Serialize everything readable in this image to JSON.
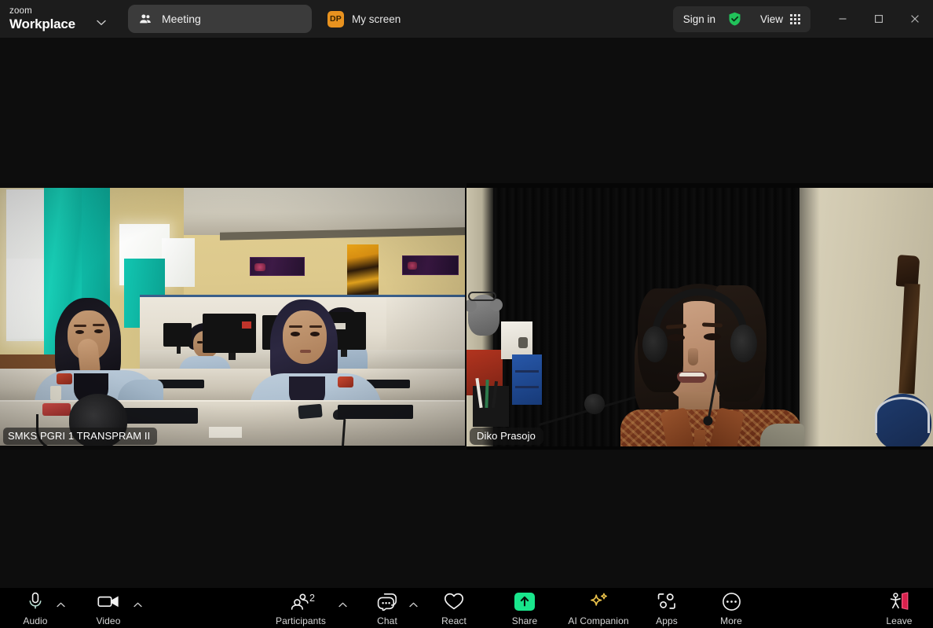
{
  "window": {
    "app_name_line1": "zoom",
    "app_name_line2": "Workplace",
    "minimize_label": "Minimize",
    "maximize_label": "Maximize",
    "close_label": "Close"
  },
  "titlebar": {
    "meeting_tab_label": "Meeting",
    "my_screen_label": "My screen",
    "my_screen_avatar_initials": "DP",
    "my_screen_avatar_color": "#e8921f",
    "sign_in_label": "Sign in",
    "view_label": "View",
    "shield_color": "#21c25a",
    "background_color": "#1c1c1c"
  },
  "stage": {
    "background_color": "#0d0d0d",
    "tiles": [
      {
        "name_label": "SMKS PGRI 1 TRANSPRAM II",
        "scene": "classroom-computer-lab"
      },
      {
        "name_label": "Diko Prasojo",
        "scene": "home-office-headset"
      }
    ]
  },
  "toolbar": {
    "background_color": "#000000",
    "items": [
      {
        "label": "Audio",
        "icon": "microphone-icon",
        "has_caret": true,
        "badge": ""
      },
      {
        "label": "Video",
        "icon": "camera-icon",
        "has_caret": true,
        "badge": ""
      },
      {
        "label": "Participants",
        "icon": "participants-icon",
        "has_caret": true,
        "badge": "2"
      },
      {
        "label": "Chat",
        "icon": "chat-bubble-icon",
        "has_caret": true,
        "badge": ""
      },
      {
        "label": "React",
        "icon": "heart-icon",
        "has_caret": false,
        "badge": ""
      },
      {
        "label": "Share",
        "icon": "share-screen-icon",
        "has_caret": false,
        "badge": ""
      },
      {
        "label": "AI Companion",
        "icon": "sparkle-icon",
        "has_caret": false,
        "badge": ""
      },
      {
        "label": "Apps",
        "icon": "apps-icon",
        "has_caret": false,
        "badge": ""
      },
      {
        "label": "More",
        "icon": "more-dots-icon",
        "has_caret": false,
        "badge": ""
      },
      {
        "label": "Leave",
        "icon": "leave-door-icon",
        "has_caret": false,
        "badge": ""
      }
    ],
    "share_button_color": "#19e68c",
    "ai_companion_color": "#e8c04a",
    "leave_color": "#e0325a"
  }
}
